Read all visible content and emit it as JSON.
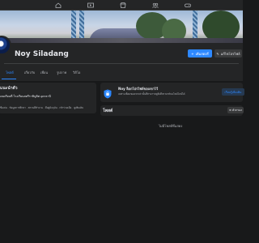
{
  "profile": {
    "name": "Noy Siladang"
  },
  "header_buttons": {
    "add_story": "เพิ่มสตอรี่",
    "edit_profile": "แก้ไขโปรไฟล์"
  },
  "tabs": [
    {
      "label": "โพสต์"
    },
    {
      "label": "เกี่ยวกับ"
    },
    {
      "label": "เพื่อน"
    },
    {
      "label": "รูปภาพ"
    },
    {
      "label": "วิดีโอ"
    }
  ],
  "intro": {
    "title": "แนะนำตัว",
    "school": "เคยเรียนที่ โรงเรียนสตรีราชินูทิศ อุดรธานี",
    "details": "ชื่อเล่น · ข้อมูลการศึกษา · สถานที่ทำงาน · ที่อยู่ปัจจุบัน · เข้าร่วมเมื่อ · ดูเพิ่มเติม"
  },
  "lock_card": {
    "title": "Noy ล็อกโปรไฟล์ของเขาไว้",
    "description": "เฉพาะเพื่อนของเขาเท่านั้นที่สามารถดูสิ่งที่เขาแชร์บนไทม์ไลน์ได้",
    "learn_more": "เรียนรู้เพิ่มเติม"
  },
  "posts": {
    "title": "โพสต์",
    "filter": "ตัวกรอง",
    "empty": "ไม่มีโพสต์ที่แสดง"
  },
  "colors": {
    "accent": "#2d88ff",
    "background": "#18191a",
    "card": "#242526"
  }
}
